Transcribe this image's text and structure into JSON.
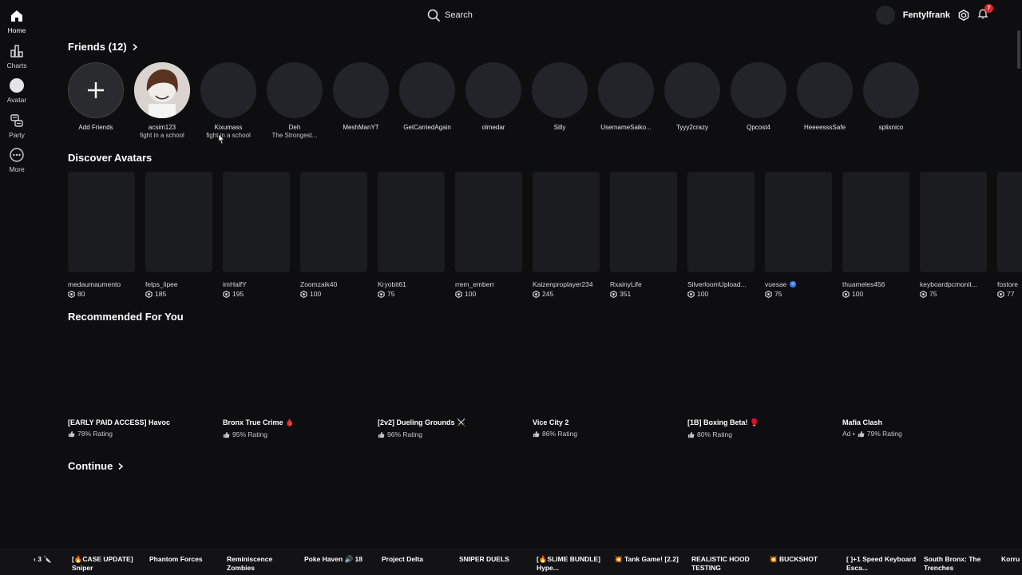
{
  "nav": {
    "items": [
      {
        "label": "Home",
        "icon": "home-icon"
      },
      {
        "label": "Charts",
        "icon": "charts-icon"
      },
      {
        "label": "Avatar",
        "icon": "avatar-icon"
      },
      {
        "label": "Party",
        "icon": "party-icon"
      },
      {
        "label": "More",
        "icon": "more-icon"
      }
    ]
  },
  "topbar": {
    "search_label": "Search",
    "username": "Fentylfrank",
    "notification_count": "7"
  },
  "friends": {
    "title": "Friends (12)",
    "add_label": "Add Friends",
    "list": [
      {
        "name": "acsim123",
        "status": "fight in a school"
      },
      {
        "name": "Kixumass",
        "status": "fight in a school"
      },
      {
        "name": "Deh",
        "status": "The Strongest..."
      },
      {
        "name": "MeshManYT",
        "status": ""
      },
      {
        "name": "GetCarriedAgain",
        "status": ""
      },
      {
        "name": "olmedar",
        "status": ""
      },
      {
        "name": "Silly",
        "status": ""
      },
      {
        "name": "UsernameSaiko...",
        "status": ""
      },
      {
        "name": "Tyyy2crazy",
        "status": ""
      },
      {
        "name": "Qpcost4",
        "status": ""
      },
      {
        "name": "HeeeesssSafe",
        "status": ""
      },
      {
        "name": "splixnico",
        "status": ""
      }
    ]
  },
  "discover": {
    "title": "Discover Avatars",
    "avatars": [
      {
        "name": "medaumaumento",
        "price": "80"
      },
      {
        "name": "felps_lipee",
        "price": "185"
      },
      {
        "name": "imHalfY",
        "price": "195"
      },
      {
        "name": "Zoomzaik40",
        "price": "100"
      },
      {
        "name": "Kryobit61",
        "price": "75"
      },
      {
        "name": "rrem_emberr",
        "price": "100"
      },
      {
        "name": "Kaizenproplayer234",
        "price": "245"
      },
      {
        "name": "RxainyLife",
        "price": "351"
      },
      {
        "name": "SilverloomUpload...",
        "price": "100"
      },
      {
        "name": "vuesae",
        "price": "75",
        "verified": true
      },
      {
        "name": "thuameles456",
        "price": "100"
      },
      {
        "name": "keyboardpcmonit...",
        "price": "75"
      },
      {
        "name": "fostore",
        "price": "77"
      }
    ]
  },
  "recommended": {
    "title": "Recommended For You",
    "games": [
      {
        "title": "[EARLY PAID ACCESS] Havoc",
        "rating": "78% Rating",
        "ad": ""
      },
      {
        "title": "Bronx True Crime 🩸",
        "rating": "95% Rating",
        "ad": ""
      },
      {
        "title": "[2v2] Dueling Grounds ⚔️",
        "rating": "96% Rating",
        "ad": ""
      },
      {
        "title": "Vice City 2",
        "rating": "86% Rating",
        "ad": ""
      },
      {
        "title": "[1B] Boxing Beta! 🥊",
        "rating": "80% Rating",
        "ad": ""
      },
      {
        "title": "Mafia Clash",
        "rating": "79% Rating",
        "ad": "Ad •"
      }
    ]
  },
  "continue": {
    "title": "Continue"
  },
  "bottom_strip": {
    "page": "‹ 3 🔪",
    "items": [
      "[🔥CASE UPDATE] Sniper",
      "Phantom Forces",
      "Reminiscence Zombies",
      "Poke Haven 🔊 18",
      "Project Delta",
      "SNIPER DUELS",
      "[🔥SLIME BUNDLE] Hype...",
      "💥 Tank Game! [2.2]",
      "REALISTIC HOOD TESTING",
      "💥 BUCKSHOT",
      "[ ]+1 Speed Keyboard Esca...",
      "South Bronx: The Trenches",
      "Korru"
    ]
  },
  "colors": {
    "background": "#0e0e10",
    "card": "#1b1c1f",
    "badge": "#e0242f",
    "verified": "#3b7cf5"
  }
}
